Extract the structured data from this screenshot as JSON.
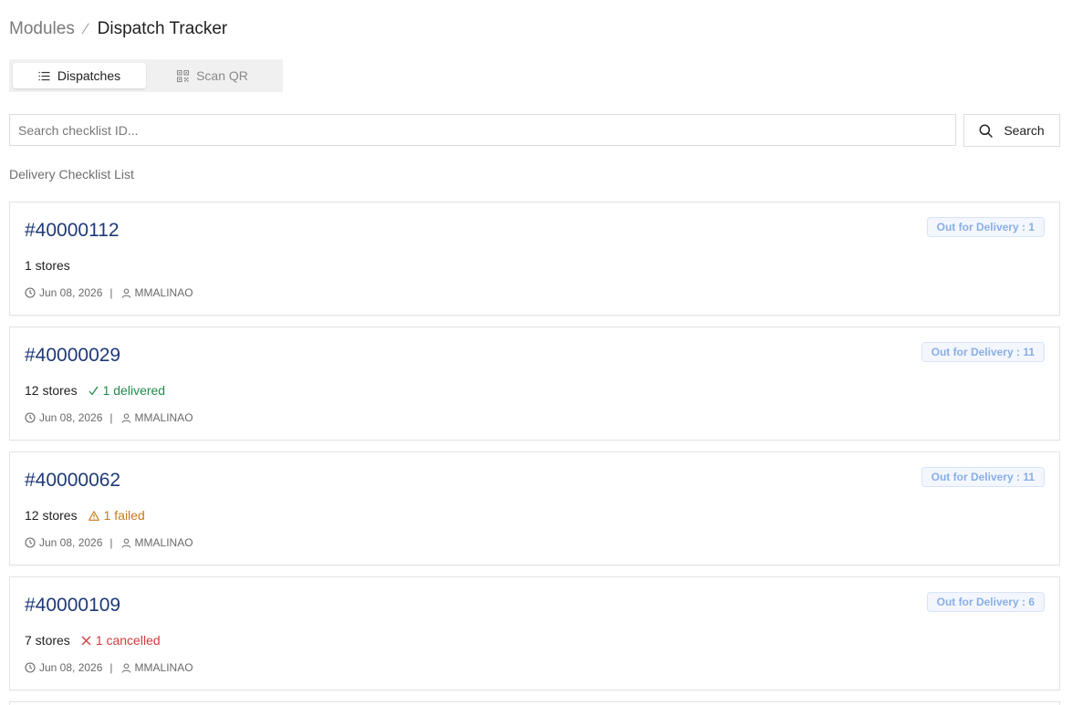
{
  "breadcrumb": {
    "parent": "Modules",
    "separator": "⁄",
    "current": "Dispatch Tracker"
  },
  "tabs": [
    {
      "label": "Dispatches",
      "icon": "list-icon",
      "active": true
    },
    {
      "label": "Scan QR",
      "icon": "qr-code-icon",
      "active": false
    }
  ],
  "search": {
    "placeholder": "Search checklist ID...",
    "value": "",
    "button_label": "Search",
    "button_icon": "search-icon"
  },
  "section_title": "Delivery Checklist List",
  "colors": {
    "id_text": "#1e3a78",
    "badge_text": "#8aaee6",
    "delivered": "#1f8a4c",
    "failed": "#c87a1a",
    "cancelled": "#d43b3b"
  },
  "checklists": [
    {
      "id": "#40000112",
      "badge": "Out for Delivery : 1",
      "stores": "1 stores",
      "status": null,
      "date": "Jun 08, 2026",
      "user": "MMALINAO"
    },
    {
      "id": "#40000029",
      "badge": "Out for Delivery : 11",
      "stores": "12 stores",
      "status": {
        "type": "delivered",
        "icon": "check-icon",
        "label": "1 delivered"
      },
      "date": "Jun 08, 2026",
      "user": "MMALINAO"
    },
    {
      "id": "#40000062",
      "badge": "Out for Delivery : 11",
      "stores": "12 stores",
      "status": {
        "type": "failed",
        "icon": "warning-icon",
        "label": "1 failed"
      },
      "date": "Jun 08, 2026",
      "user": "MMALINAO"
    },
    {
      "id": "#40000109",
      "badge": "Out for Delivery : 6",
      "stores": "7 stores",
      "status": {
        "type": "cancelled",
        "icon": "x-icon",
        "label": "1 cancelled"
      },
      "date": "Jun 08, 2026",
      "user": "MMALINAO"
    }
  ],
  "meta_separator": "|"
}
